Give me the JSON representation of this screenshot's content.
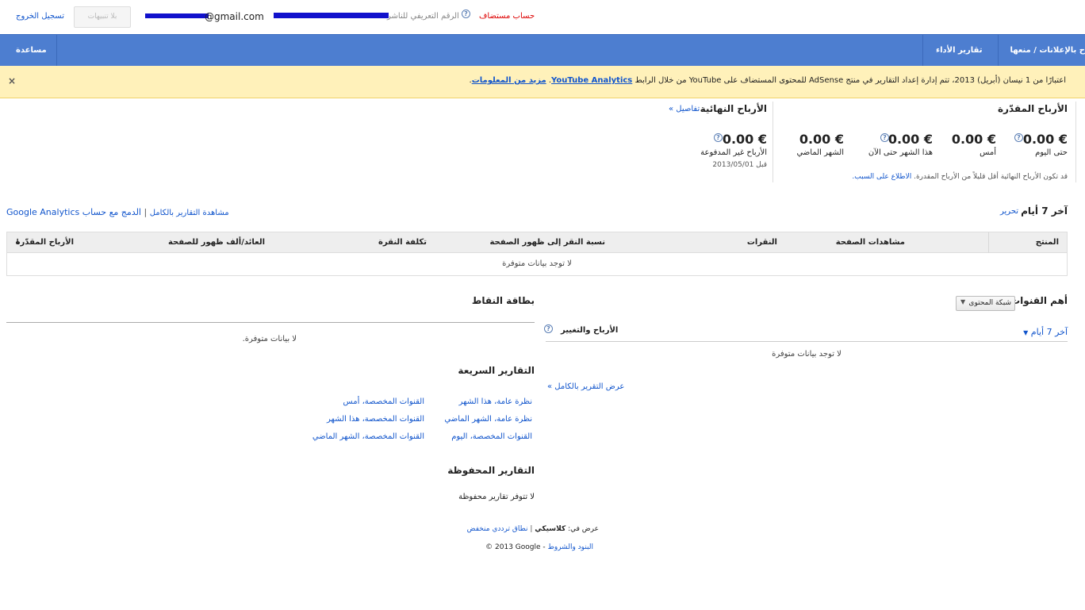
{
  "topbar": {
    "logout": "تسجيل الخروج",
    "notifications": "بلا تنبيهات",
    "email": "@gmail.com",
    "publisher_id_label": "الرقم التعريفي للناشر",
    "hosted_account": "حساب مستضاف"
  },
  "nav": {
    "help": "مساعدة",
    "performance_reports": "تقارير الأداء",
    "allow_block_ads": "ح بالإعلانات / منعها"
  },
  "banner": {
    "text_before": "اعتبارًا من 1 نيسان (أبريل) 2013، تتم إدارة إعداد التقارير في منتج AdSense للمحتوى المستضاف على YouTube من خلال الرابط",
    "link_analytics": "YouTube Analytics",
    "link_more": "مزيد من المعلومات",
    "close": "×"
  },
  "estimated": {
    "title": "الأرباح المقدّرة",
    "items": [
      {
        "value": "0.00 €",
        "label": "حتى اليوم"
      },
      {
        "value": "0.00 €",
        "label": "أمس"
      },
      {
        "value": "0.00 €",
        "label": "هذا الشهر حتى الآن"
      },
      {
        "value": "0.00 €",
        "label": "الشهر الماضي"
      }
    ],
    "note": "قد تكون الأرباح النهائية أقل قليلاً من الأرباح المقدرة.",
    "note_link": "الاطلاع على السبب."
  },
  "finalized": {
    "title": "الأرباح النهائية",
    "details_link": "تفاصيل »",
    "value": "0.00 €",
    "label": "الأرباح غير المدفوعة",
    "date": "قبل 2013/05/01"
  },
  "report": {
    "period": "آخر 7 أيام",
    "edit": "تحرير",
    "view_full": "مشاهدة التقارير بالكامل",
    "separator": "|",
    "integrate": "الدمج مع حساب Google Analytics",
    "columns": [
      "المنتج",
      "مشاهدات الصفحة",
      "النقرات",
      "نسبة النقر إلى ظهور الصفحة",
      "تكلفة النقرة",
      "العائد/ألف ظهور للصفحة",
      "الأرباح المقدّرة"
    ],
    "sort_arrow": "↓",
    "empty": "لا توجد بيانات متوفرة"
  },
  "channels": {
    "title": "أهم القنوات",
    "dropdown": "شبكة المحتوى",
    "period": "آخر 7 أيام",
    "earnings_change": "الأرباح والتغيير",
    "empty": "لا توجد بيانات متوفرة",
    "full_report": "عرض التقرير بالكامل »"
  },
  "scorecard": {
    "title": "بطاقة النقاط",
    "empty": "لا بيانات متوفرة."
  },
  "quick_reports": {
    "title": "التقارير السريعة",
    "links": [
      "نظرة عامة، هذا الشهر",
      "القنوات المخصصة، أمس",
      "نظرة عامة، الشهر الماضي",
      "القنوات المخصصة، هذا الشهر",
      "القنوات المخصصة، اليوم",
      "القنوات المخصصة، الشهر الماضي"
    ]
  },
  "saved_reports": {
    "title": "التقارير المحفوظة",
    "empty": "لا تتوفر تقارير محفوظة"
  },
  "footer": {
    "view_in": "عرض في:",
    "classic": "كلاسيكي",
    "low_bandwidth": "نطاق ترددي منخفض",
    "terms": "البنود والشروط",
    "dash": "-",
    "copyright": "© 2013 Google"
  }
}
